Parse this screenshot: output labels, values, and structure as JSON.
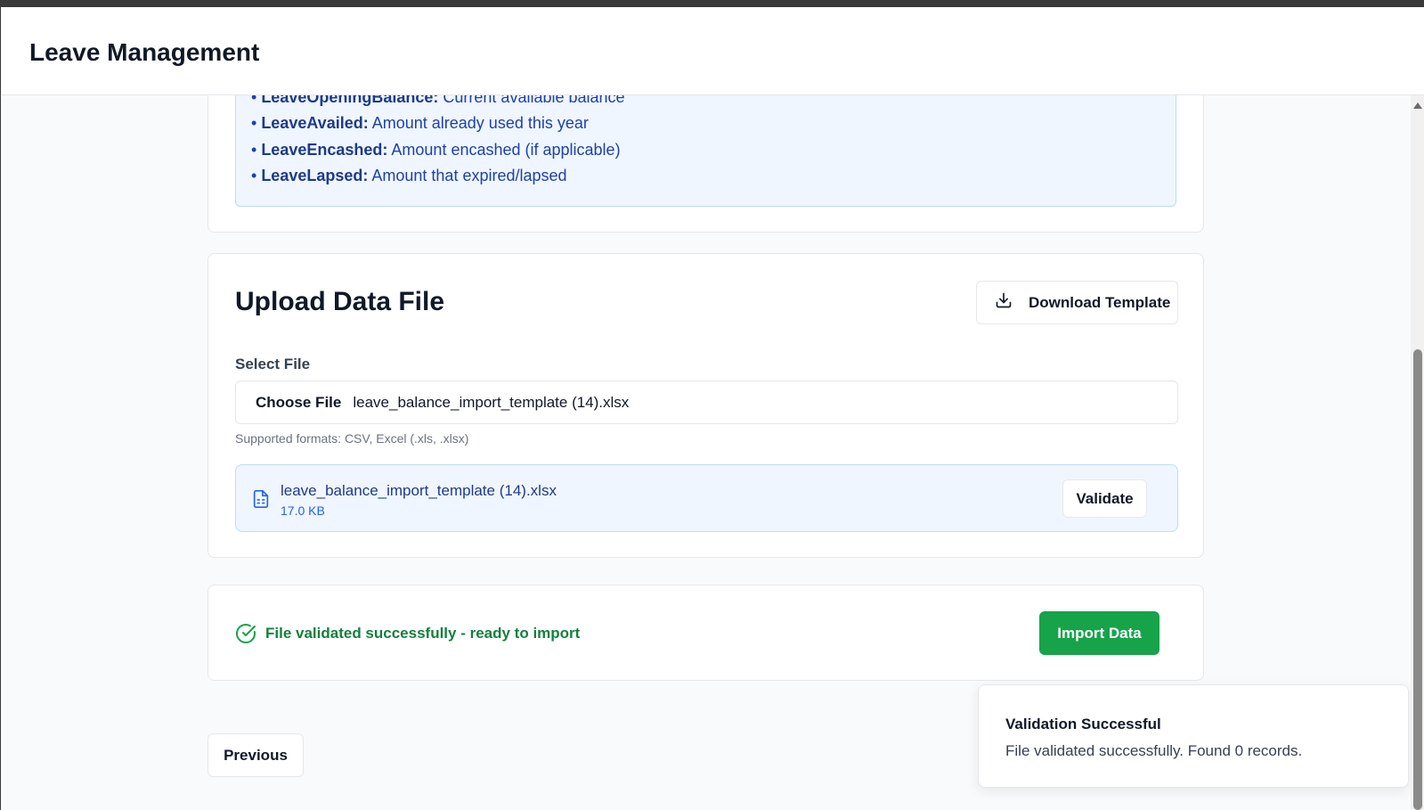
{
  "header": {
    "title": "Leave Management"
  },
  "info": {
    "items": [
      {
        "term": "LeaveOpeningBalance:",
        "desc": "Current available balance"
      },
      {
        "term": "LeaveAvailed:",
        "desc": "Amount already used this year"
      },
      {
        "term": "LeaveEncashed:",
        "desc": "Amount encashed (if applicable)"
      },
      {
        "term": "LeaveLapsed:",
        "desc": "Amount that expired/lapsed"
      }
    ]
  },
  "upload": {
    "title": "Upload Data File",
    "download_label": "Download Template",
    "select_label": "Select File",
    "choose_label": "Choose File",
    "chosen_file": "leave_balance_import_template (14).xlsx",
    "formats": "Supported formats: CSV, Excel (.xls, .xlsx)",
    "file": {
      "name": "leave_balance_import_template (14).xlsx",
      "size": "17.0 KB"
    },
    "validate_label": "Validate"
  },
  "status": {
    "message": "File validated successfully - ready to import",
    "import_label": "Import Data",
    "color": "#16a34a"
  },
  "nav": {
    "previous_label": "Previous"
  },
  "toast": {
    "title": "Validation Successful",
    "message": "File validated successfully. Found 0 records."
  },
  "icons": [
    "download-icon",
    "file-spreadsheet-icon",
    "check-circle-icon"
  ]
}
